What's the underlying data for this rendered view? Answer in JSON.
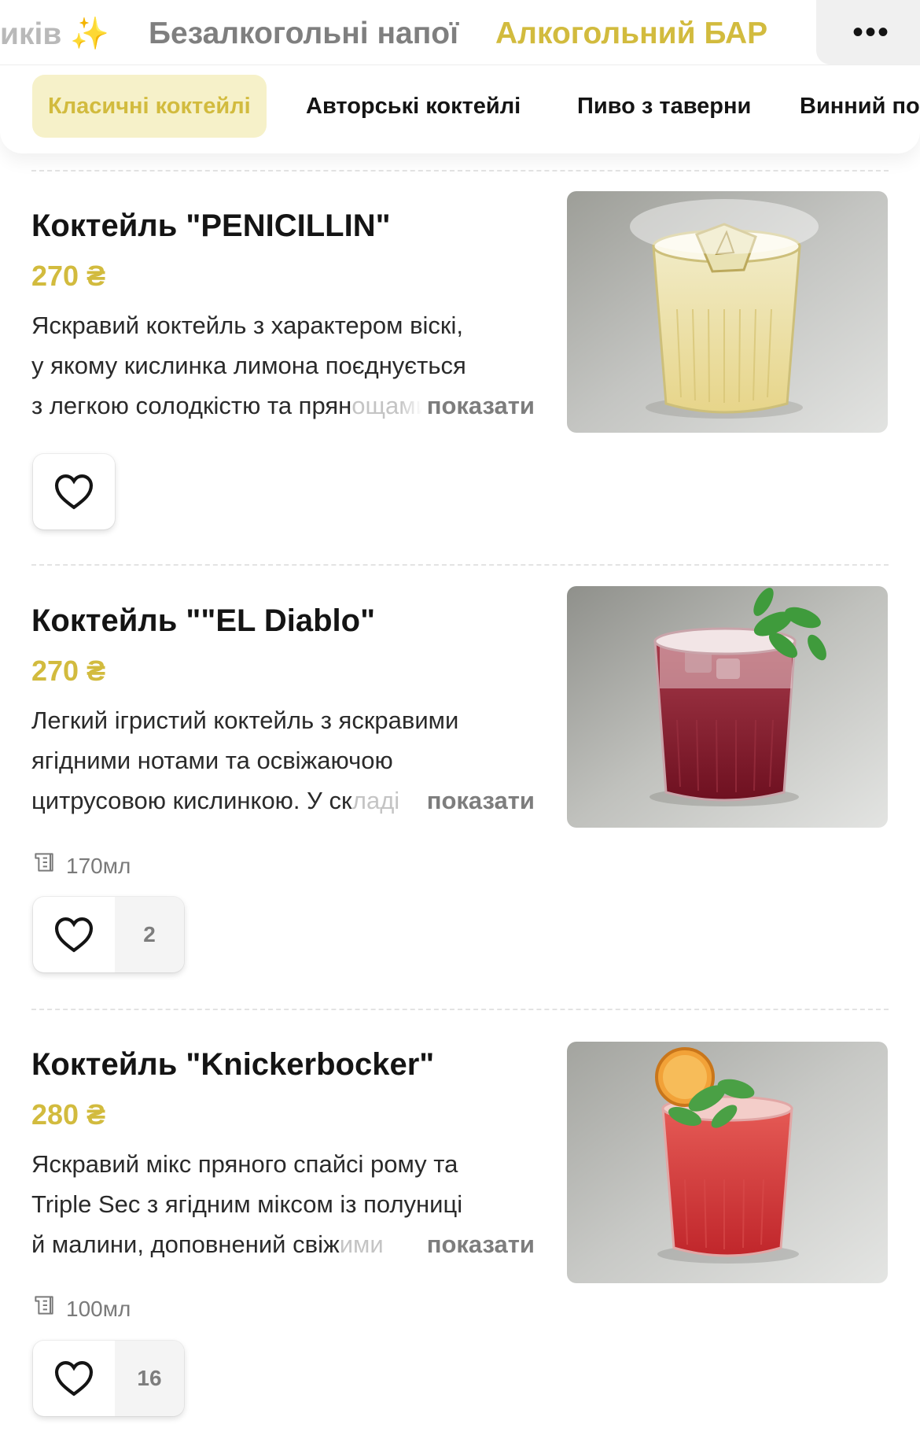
{
  "categories": {
    "prev_partial": "иків",
    "prev_icon": "sparkles-icon",
    "non_alcoholic": "Безалкогольні напої",
    "active": "Алкогольний БАР",
    "more_icon": "more-dots-icon"
  },
  "subtabs": [
    {
      "label": "Класичні коктейлі",
      "active": true
    },
    {
      "label": "Авторські коктейлі",
      "active": false
    },
    {
      "label": "Пиво з таверни",
      "active": false
    },
    {
      "label": "Винний по",
      "active": false
    }
  ],
  "show_more_label": "показати",
  "colors": {
    "accent": "#d2bb3e",
    "accent_bg": "#f6f1c9"
  },
  "items": [
    {
      "title": "Коктейль \"PENICILLIN\"",
      "price": "270 ₴",
      "desc_lines": [
        "Яскравий коктейль з характером віскі,",
        "у якому кислинка лимона поєднується",
        "з легкою солодкістю та прян"
      ],
      "desc_fade": "ощами",
      "volume": "",
      "likes": "",
      "photo": "yellow-whisky-cocktail-with-ice-and-smoke"
    },
    {
      "title": "Коктейль \"\"EL Diablo\"",
      "price": "270 ₴",
      "desc_lines": [
        "Легкий ігристий коктейль з яскравими",
        "ягідними нотами та освіжаючою",
        "цитрусовою кислинкою. У ск"
      ],
      "desc_fade": "ладі",
      "volume": "170мл",
      "likes": "2",
      "photo": "red-berry-cocktail-with-mint"
    },
    {
      "title": "Коктейль \"Knickerbocker\"",
      "price": "280 ₴",
      "desc_lines": [
        "Яскравий мікс пряного спайсі рому та",
        "Triple Sec з ягідним міксом із полуниці",
        "й малини, доповнений свіж"
      ],
      "desc_fade": "ими",
      "volume": "100мл",
      "likes": "16",
      "photo": "red-cocktail-with-orange-slice-and-mint"
    }
  ]
}
